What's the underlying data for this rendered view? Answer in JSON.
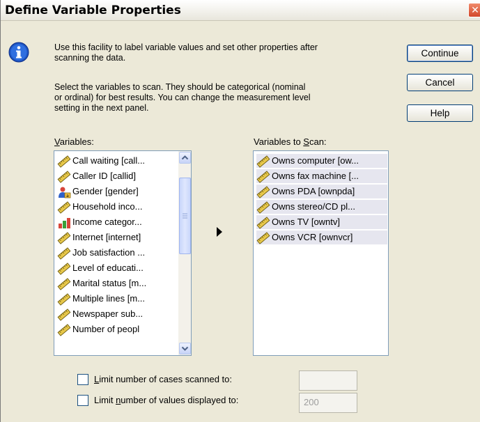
{
  "window": {
    "title": "Define Variable Properties"
  },
  "description": {
    "line1": "Use this facility to label variable values and set other properties after",
    "line2": "scanning the data.",
    "line3": "Select the variables to scan.  They should be categorical (nominal",
    "line4": "or ordinal) for best results.  You can change the  measurement level",
    "line5": "setting in the next panel."
  },
  "buttons": {
    "continue": "Continue",
    "cancel": "Cancel",
    "help": "Help"
  },
  "variables": {
    "label_prefix": "V",
    "label_rest": "ariables:",
    "items": [
      {
        "label": "Call waiting [call...",
        "icon": "ruler-icon"
      },
      {
        "label": "Caller ID [callid]",
        "icon": "ruler-icon"
      },
      {
        "label": "Gender [gender]",
        "icon": "nominal-icon"
      },
      {
        "label": "Household inco...",
        "icon": "ruler-icon"
      },
      {
        "label": "Income categor...",
        "icon": "bar-chart-icon"
      },
      {
        "label": "Internet [internet]",
        "icon": "ruler-icon"
      },
      {
        "label": "Job satisfaction ...",
        "icon": "ruler-icon"
      },
      {
        "label": "Level of educati...",
        "icon": "ruler-icon"
      },
      {
        "label": "Marital status [m...",
        "icon": "ruler-icon"
      },
      {
        "label": "Multiple lines [m...",
        "icon": "ruler-icon"
      },
      {
        "label": "Newspaper sub...",
        "icon": "ruler-icon"
      },
      {
        "label": "Number of peopl",
        "icon": "ruler-icon"
      }
    ]
  },
  "scan": {
    "label_prefix": "Variables to ",
    "label_ul": "S",
    "label_rest": "can:",
    "items": [
      {
        "label": "Owns computer [ow..."
      },
      {
        "label": "Owns fax machine [..."
      },
      {
        "label": "Owns PDA [ownpda]"
      },
      {
        "label": "Owns stereo/CD pl..."
      },
      {
        "label": "Owns TV [owntv]"
      },
      {
        "label": "Owns VCR [ownvcr]"
      }
    ]
  },
  "options": {
    "limit_cases_ul": "L",
    "limit_cases_rest": "imit number of cases scanned to:",
    "limit_cases_value": "",
    "limit_values_pre": "Limit ",
    "limit_values_ul": "n",
    "limit_values_rest": "umber of values displayed to:",
    "limit_values_value": "200"
  }
}
